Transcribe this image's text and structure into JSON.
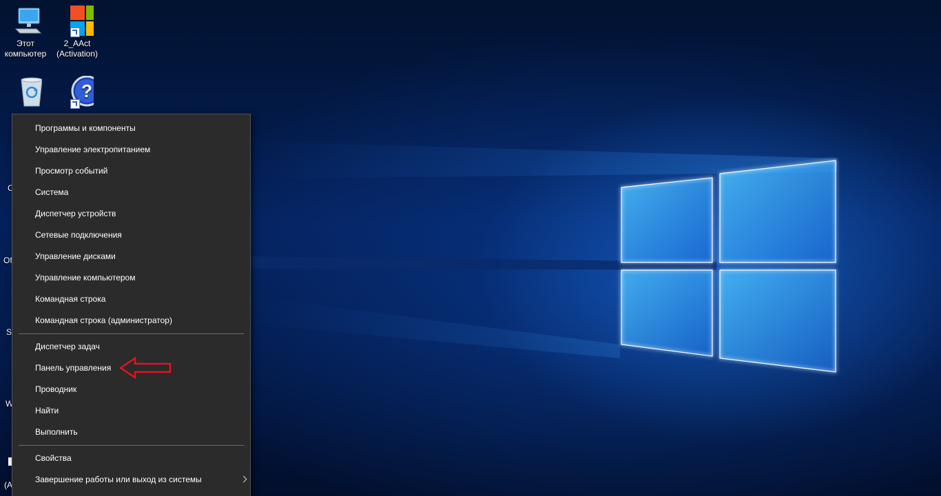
{
  "desktop": {
    "icons": [
      {
        "label_line1": "Этот",
        "label_line2": "компьютер",
        "icon": "computer-icon"
      },
      {
        "label_line1": "2_AAct",
        "label_line2": "(Activation)",
        "icon": "windows-logo-icon"
      },
      {
        "label_line1": "",
        "label_line2": "",
        "icon": "recycle-bin-icon"
      },
      {
        "label_line1": "",
        "label_line2": "",
        "icon": "help-question-icon"
      }
    ],
    "partial_labels": [
      "C",
      "Of",
      "S",
      "W",
      "(A"
    ]
  },
  "menu": {
    "group1": [
      "Программы и компоненты",
      "Управление электропитанием",
      "Просмотр событий",
      "Система",
      "Диспетчер устройств",
      "Сетевые подключения",
      "Управление дисками",
      "Управление компьютером",
      "Командная строка",
      "Командная строка (администратор)"
    ],
    "group2": [
      "Диспетчер задач",
      "Панель управления",
      "Проводник",
      "Найти",
      "Выполнить"
    ],
    "group3": [
      "Свойства",
      "Завершение работы или выход из системы"
    ]
  },
  "colors": {
    "menu_bg": "#2b2b2b",
    "menu_text": "#ffffff",
    "annotation": "#e0141e",
    "wallpaper_accent": "#1e78e6"
  }
}
